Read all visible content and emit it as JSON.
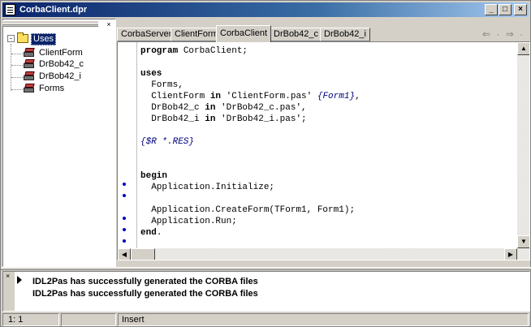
{
  "window": {
    "title": "CorbaClient.dpr"
  },
  "explorer": {
    "root_label": "Uses",
    "items": [
      "ClientForm",
      "DrBob42_c",
      "DrBob42_i",
      "Forms"
    ]
  },
  "tabs": [
    {
      "label": "CorbaServer"
    },
    {
      "label": "ClientForm"
    },
    {
      "label": "CorbaClient"
    },
    {
      "label": "DrBob42_c"
    },
    {
      "label": "DrBob42_i"
    }
  ],
  "nav_arrows": "⇐ · ⇒ ·",
  "code": {
    "l1_kw": "program",
    "l1_rest": " CorbaClient;",
    "l2_kw": "uses",
    "l3": "  Forms,",
    "l4_a": "  ClientForm ",
    "l4_kw": "in",
    "l4_str": " 'ClientForm.pas' ",
    "l4_cmt": "{Form1}",
    "l4_end": ",",
    "l5_a": "  DrBob42_c ",
    "l5_kw": "in",
    "l5_str": " 'DrBob42_c.pas',",
    "l6_a": "  DrBob42_i ",
    "l6_kw": "in",
    "l6_str": " 'DrBob42_i.pas';",
    "l7_cmt": "{$R *.RES}",
    "l8_kw": "begin",
    "l9": "  Application.Initialize;",
    "l10": "  Application.CreateForm(TForm1, Form1);",
    "l11": "  Application.Run;",
    "l12_kw": "end",
    "l12_end": "."
  },
  "messages": [
    "IDL2Pas has successfully generated the CORBA files",
    "IDL2Pas has successfully generated the CORBA files"
  ],
  "status": {
    "position": "1:   1",
    "mode": "Insert"
  }
}
